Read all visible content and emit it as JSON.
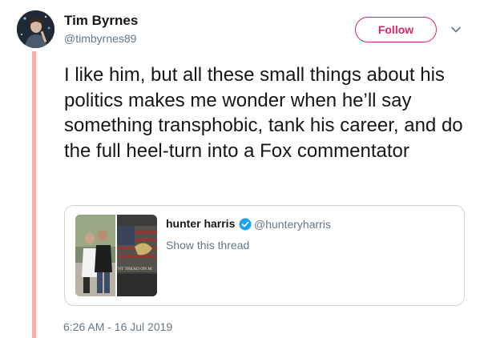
{
  "tweet": {
    "author_name": "Tim Byrnes",
    "author_handle": "@timbyrnes89",
    "follow_label": "Follow",
    "text": "I like him, but all these small things about his politics makes me wonder when he’ll say something transphobic, tank his career, and do the full heel-turn into a Fox commentator",
    "timestamp": "6:26 AM - 16 Jul 2019"
  },
  "quoted_tweet": {
    "author_name": "hunter harris",
    "author_handle": "@hunteryharris",
    "show_thread_label": "Show this thread",
    "thumbnail_flag_text": "NT TREAD ON M"
  },
  "icons": {
    "avatar": "avatar-image",
    "dropdown": "chevron-down-icon",
    "verified": "verified-badge-icon"
  },
  "colors": {
    "accent": "#e0245e",
    "thread_line": "#f5b1a5",
    "secondary_text": "#657786",
    "verified": "#1da1f2",
    "border": "#ccd6dd"
  }
}
